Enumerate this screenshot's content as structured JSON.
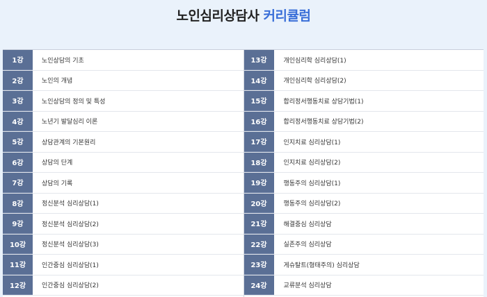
{
  "title": {
    "main": "노인심리상담사",
    "accent": "커리큘럼"
  },
  "curriculum": {
    "left": [
      {
        "num": "1강",
        "label": "노인상담의 기초"
      },
      {
        "num": "2강",
        "label": "노인의 개념"
      },
      {
        "num": "3강",
        "label": "노인상담의 정의 및 특성"
      },
      {
        "num": "4강",
        "label": "노년기 발달심리 이론"
      },
      {
        "num": "5강",
        "label": "상담관계의 기본원리"
      },
      {
        "num": "6강",
        "label": "상담의 단계"
      },
      {
        "num": "7강",
        "label": "상담의 기록"
      },
      {
        "num": "8강",
        "label": "정신분석 심리상담(1)"
      },
      {
        "num": "9강",
        "label": "정신분석 심리상담(2)"
      },
      {
        "num": "10강",
        "label": "정신분석 심리상담(3)"
      },
      {
        "num": "11강",
        "label": "인간중심 심리상담(1)"
      },
      {
        "num": "12강",
        "label": "인간중심 심리상담(2)"
      }
    ],
    "right": [
      {
        "num": "13강",
        "label": "개인심리학 심리상담(1)"
      },
      {
        "num": "14강",
        "label": "개인심리학 심리상담(2)"
      },
      {
        "num": "15강",
        "label": "합리정서행동치료 상담기법(1)"
      },
      {
        "num": "16강",
        "label": "합리정서행동치료 상담기법(2)"
      },
      {
        "num": "17강",
        "label": "인지치료 심리상담(1)"
      },
      {
        "num": "18강",
        "label": "인지치료 심리상담(2)"
      },
      {
        "num": "19강",
        "label": "행동주의 심리상담(1)"
      },
      {
        "num": "20강",
        "label": "행동주의 심리상담(2)"
      },
      {
        "num": "21강",
        "label": "해결중심 심리상담"
      },
      {
        "num": "22강",
        "label": "실존주의 심리상담"
      },
      {
        "num": "23강",
        "label": "게슈탈트(형태주의) 심리상담"
      },
      {
        "num": "24강",
        "label": "교류분석 심리상담"
      }
    ]
  },
  "colors": {
    "accent": "#3a6fd8",
    "number_cell": "#5a6f95",
    "background": "#eaf2fb"
  }
}
